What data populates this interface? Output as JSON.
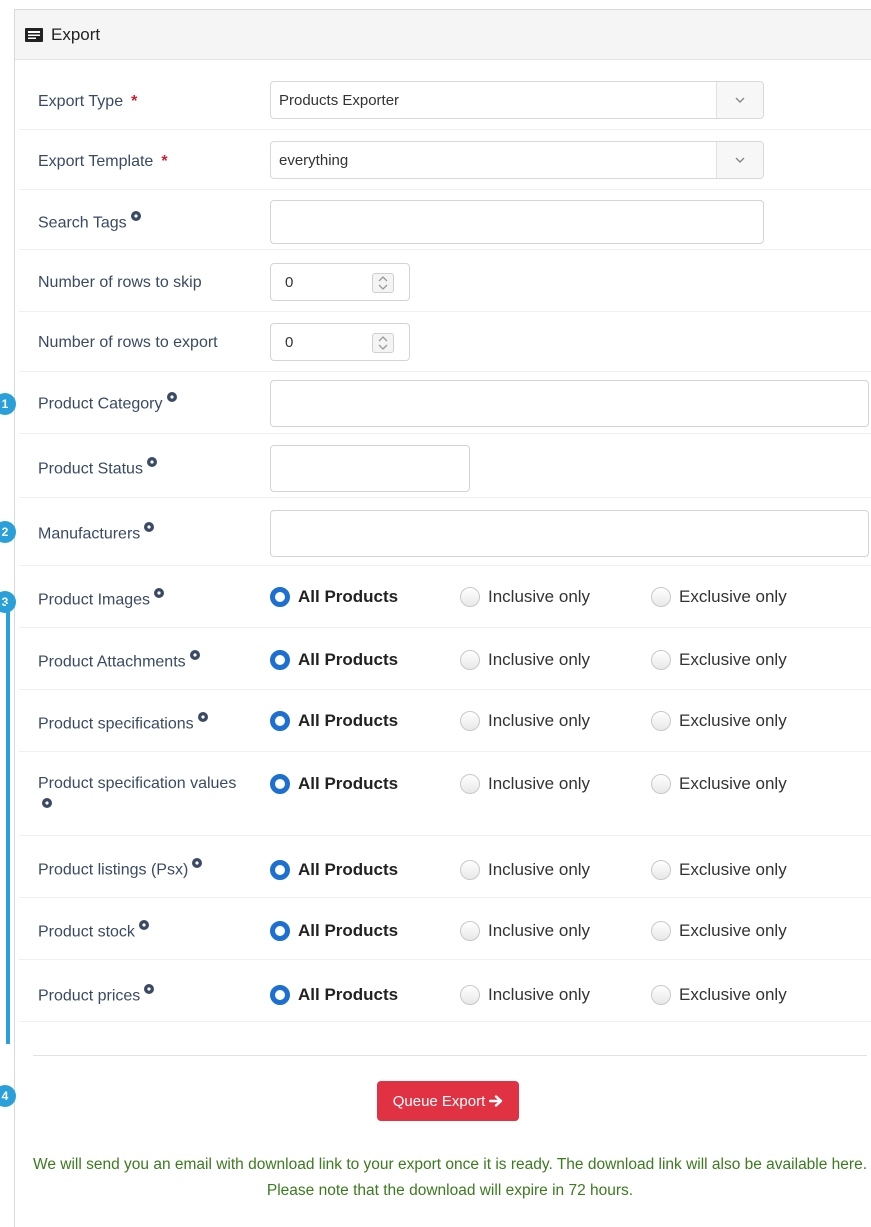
{
  "panel": {
    "title": "Export",
    "icon": "export-card-icon"
  },
  "form": {
    "export_type": {
      "label": "Export Type",
      "required_mark": "*",
      "value": "Products Exporter"
    },
    "export_template": {
      "label": "Export Template",
      "required_mark": "*",
      "value": "everything"
    },
    "search_tags": {
      "label": "Search Tags",
      "value": ""
    },
    "rows_skip": {
      "label": "Number of rows to skip",
      "value": "0"
    },
    "rows_export": {
      "label": "Number of rows to export",
      "value": "0"
    },
    "product_category": {
      "label": "Product Category",
      "value": ""
    },
    "product_status": {
      "label": "Product Status",
      "value": ""
    },
    "manufacturers": {
      "label": "Manufacturers",
      "value": ""
    },
    "radio_options": [
      "All Products",
      "Inclusive only",
      "Exclusive only"
    ],
    "radio_rows": [
      {
        "label": "Product Images",
        "selected": "All Products"
      },
      {
        "label": "Product Attachments",
        "selected": "All Products"
      },
      {
        "label": "Product specifications",
        "selected": "All Products"
      },
      {
        "label": "Product specification values",
        "selected": "All Products"
      },
      {
        "label": "Product listings (Psx)",
        "selected": "All Products"
      },
      {
        "label": "Product stock",
        "selected": "All Products"
      },
      {
        "label": "Product prices",
        "selected": "All Products"
      }
    ]
  },
  "badges": [
    "1",
    "2",
    "3",
    "4"
  ],
  "actions": {
    "queue_label": "Queue Export",
    "queue_icon": "arrow-right-icon"
  },
  "notice": "We will send you an email with download link to your export once it is ready. The download link will also be available here. Please note that the download will expire in 72 hours.",
  "colors": {
    "accent": "#2aa0db",
    "danger": "#e03242",
    "radio": "#1d6fd1",
    "notice": "#3c7a1f",
    "required": "#cc1f2f"
  }
}
